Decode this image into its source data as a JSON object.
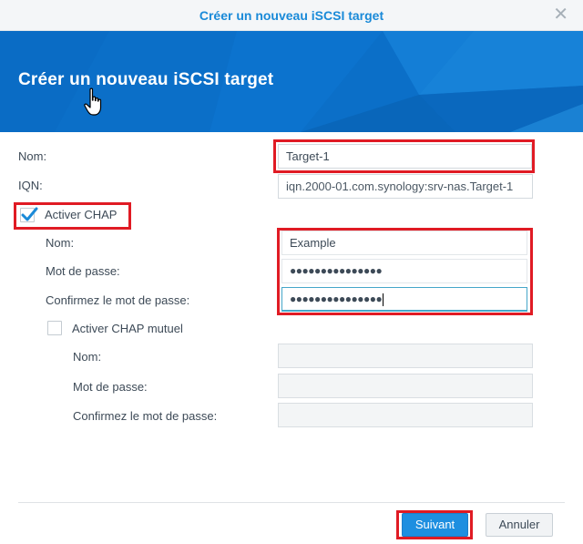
{
  "window": {
    "title": "Créer un nouveau iSCSI target",
    "close_icon": "close-icon"
  },
  "banner": {
    "title": "Créer un nouveau iSCSI target",
    "color": "#0b6fc8"
  },
  "form": {
    "name_label": "Nom:",
    "name_value": "Target-1",
    "iqn_label": "IQN:",
    "iqn_value": "iqn.2000-01.com.synology:srv-nas.Target-1",
    "chap": {
      "checkbox_label": "Activer CHAP",
      "checked": true,
      "name_label": "Nom:",
      "name_value": "Example",
      "password_label": "Mot de passe:",
      "password_value": "●●●●●●●●●●●●●●●",
      "confirm_label": "Confirmez le mot de passe:",
      "confirm_value": "●●●●●●●●●●●●●●●"
    },
    "mutual_chap": {
      "checkbox_label": "Activer CHAP mutuel",
      "checked": false,
      "name_label": "Nom:",
      "password_label": "Mot de passe:",
      "confirm_label": "Confirmez le mot de passe:"
    }
  },
  "footer": {
    "next_label": "Suivant",
    "cancel_label": "Annuler"
  },
  "colors": {
    "accent": "#1a8ad8",
    "highlight": "#e01b24",
    "primary_button": "#1e8fe0"
  }
}
